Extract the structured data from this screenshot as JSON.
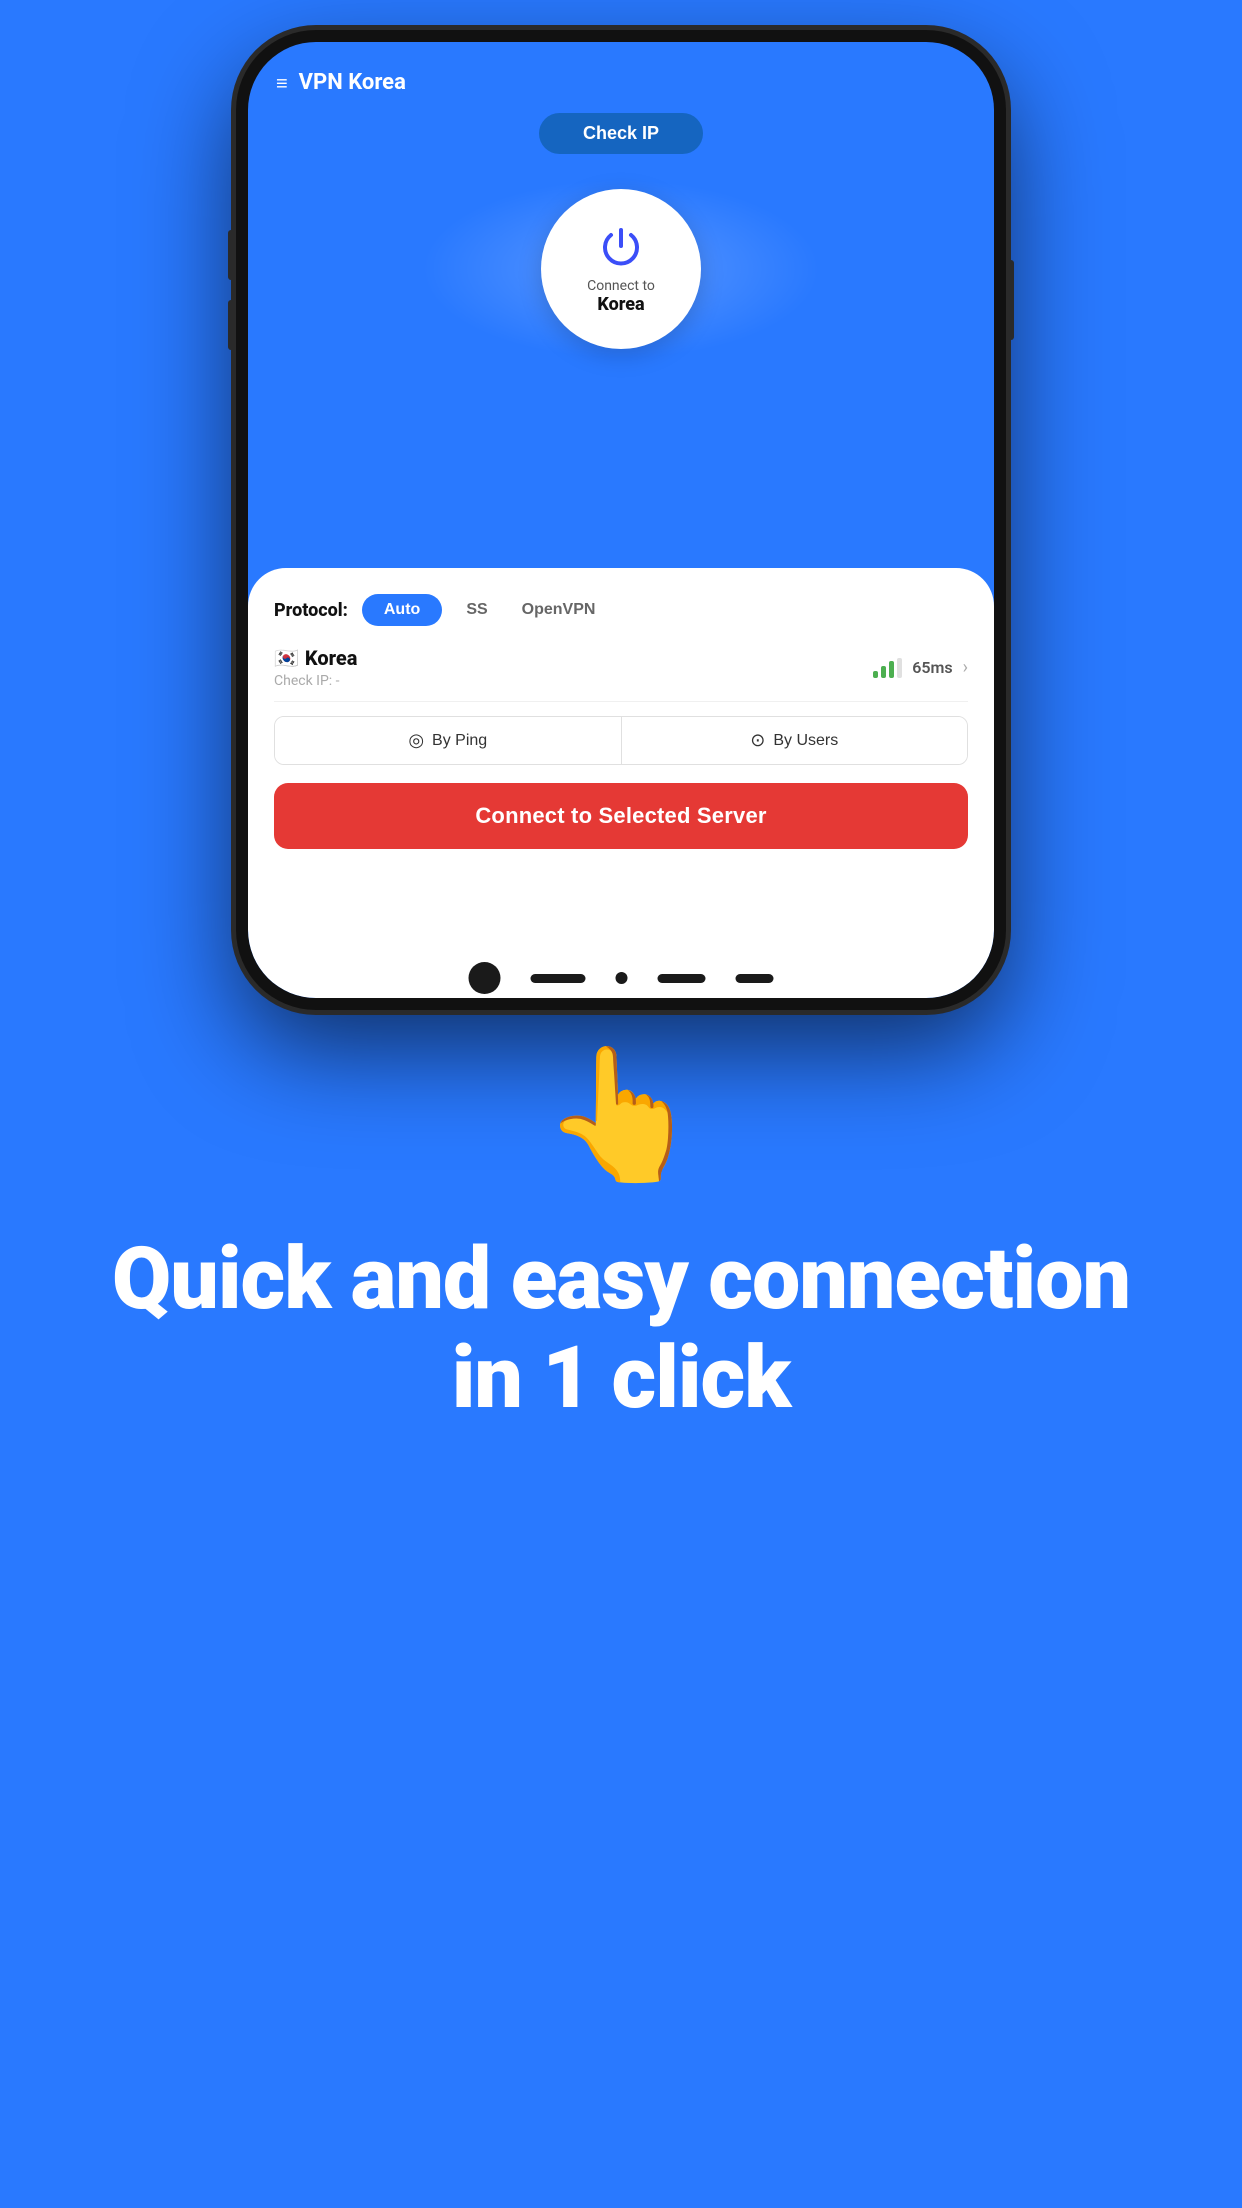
{
  "background_color": "#2979FF",
  "header": {
    "app_title": "VPN Korea",
    "menu_icon": "≡"
  },
  "check_ip_button": {
    "label": "Check IP"
  },
  "power_button": {
    "connect_to_label": "Connect to",
    "country": "Korea"
  },
  "protocol": {
    "label": "Protocol:",
    "options": [
      "Auto",
      "SS",
      "OpenVPN"
    ],
    "active": "Auto"
  },
  "server": {
    "flag": "🇰🇷",
    "name": "Korea",
    "ip_label": "Check IP: -",
    "ping": "65ms"
  },
  "sort": {
    "by_ping_label": "By Ping",
    "by_users_label": "By Users",
    "ping_icon": "◎",
    "users_icon": "⊙"
  },
  "connect_button": {
    "label": "Connect to Selected Server"
  },
  "bottom": {
    "hand_emoji": "👆",
    "tagline": "Quick and easy connection in 1 click"
  }
}
